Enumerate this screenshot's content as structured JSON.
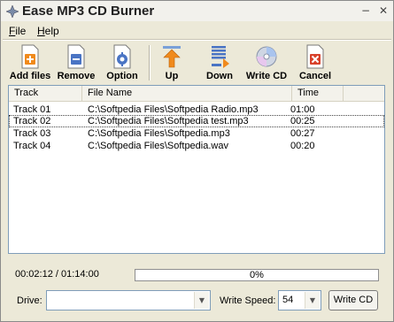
{
  "window": {
    "title": "Ease MP3 CD Burner",
    "minimize": "−",
    "close": "✕"
  },
  "menu": {
    "file": "File",
    "help": "Help"
  },
  "toolbar": [
    {
      "label": "Add files",
      "icon": "add-files-icon"
    },
    {
      "label": "Remove",
      "icon": "remove-icon"
    },
    {
      "label": "Option",
      "icon": "option-icon"
    },
    {
      "label": "Up",
      "icon": "up-arrow-icon"
    },
    {
      "label": "Down",
      "icon": "down-arrow-icon"
    },
    {
      "label": "Write CD",
      "icon": "cd-icon"
    },
    {
      "label": "Cancel",
      "icon": "cancel-icon"
    }
  ],
  "table": {
    "headers": {
      "track": "Track",
      "file": "File Name",
      "time": "Time"
    },
    "rows": [
      {
        "track": "Track 01",
        "file": "C:\\Softpedia Files\\Softpedia Radio.mp3",
        "time": "01:00"
      },
      {
        "track": "Track 02",
        "file": "C:\\Softpedia Files\\Softpedia test.mp3",
        "time": "00:25"
      },
      {
        "track": "Track 03",
        "file": "C:\\Softpedia Files\\Softpedia.mp3",
        "time": "00:27"
      },
      {
        "track": "Track 04",
        "file": "C:\\Softpedia Files\\Softpedia.wav",
        "time": "00:20"
      }
    ],
    "selected_row": 1
  },
  "status": {
    "time": "00:02:12 / 01:14:00",
    "progress_percent": 0,
    "progress_text": "0%"
  },
  "drive": {
    "label": "Drive:",
    "value": ""
  },
  "speed": {
    "label": "Write Speed:",
    "value": "54"
  },
  "write_button": "Write CD",
  "colors": {
    "accent": "#3169c6",
    "background": "#ECE9D8"
  }
}
